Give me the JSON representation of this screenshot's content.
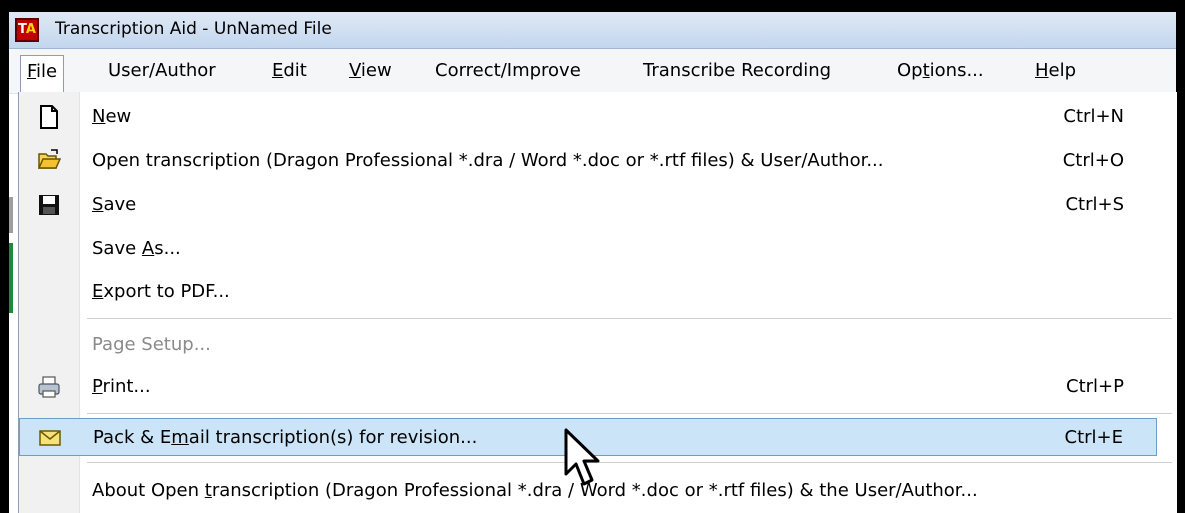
{
  "window": {
    "title": "Transcription Aid - UnNamed File",
    "icon_text": "TA",
    "accent": "#c00000"
  },
  "menubar": {
    "items": [
      {
        "label": "File",
        "mnemonic_index": 0,
        "open": true
      },
      {
        "label": "User/Author"
      },
      {
        "label": "Edit"
      },
      {
        "label": "View"
      },
      {
        "label": "Correct/Improve"
      },
      {
        "label": "Transcribe Recording"
      },
      {
        "label": "Options..."
      },
      {
        "label": "Help"
      }
    ]
  },
  "file_menu": {
    "items": [
      {
        "label": "New",
        "shortcut": "Ctrl+N",
        "icon": "new-document-icon"
      },
      {
        "label": "Open transcription (Dragon Professional *.dra / Word *.doc or *.rtf files) & User/Author...",
        "shortcut": "Ctrl+O",
        "icon": "open-folder-icon"
      },
      {
        "label": "Save",
        "shortcut": "Ctrl+S",
        "icon": "save-disk-icon"
      },
      {
        "label": "Save As...",
        "shortcut": ""
      },
      {
        "label": "Export to PDF...",
        "shortcut": ""
      },
      {
        "label": "Page Setup...",
        "shortcut": "",
        "disabled": true
      },
      {
        "label": "Print...",
        "shortcut": "Ctrl+P",
        "icon": "printer-icon"
      },
      {
        "label": "Pack & Email transcription(s) for revision...",
        "shortcut": "Ctrl+E",
        "icon": "envelope-icon",
        "selected": true
      },
      {
        "label": "About Open transcription (Dragon Professional *.dra / Word *.doc or *.rtf files) & the User/Author...",
        "shortcut": ""
      }
    ]
  },
  "colors": {
    "selection_bg": "#cce4f7",
    "selection_border": "#6d9ec9",
    "disabled_text": "#8a8a8a"
  }
}
